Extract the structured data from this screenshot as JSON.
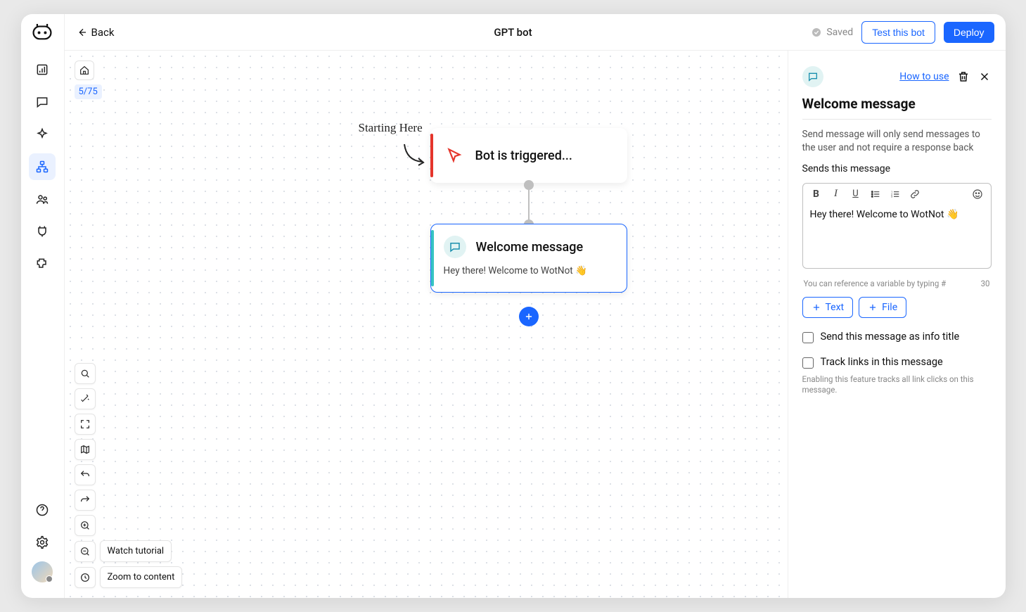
{
  "header": {
    "back_label": "Back",
    "title": "GPT bot",
    "saved_label": "Saved",
    "test_label": "Test this bot",
    "deploy_label": "Deploy"
  },
  "canvas": {
    "node_counter": "5/75",
    "starting_label": "Starting Here",
    "trigger_label": "Bot is triggered...",
    "message_label": "Welcome message",
    "message_preview": "Hey there! Welcome to WotNot 👋",
    "watch_tutorial": "Watch tutorial",
    "zoom_to_content": "Zoom to content"
  },
  "panel": {
    "how_to_use": "How to use",
    "title": "Welcome message",
    "description": "Send message will only send messages to the user and not require a response back",
    "sends_label": "Sends this message",
    "message_value": "Hey there! Welcome to WotNot 👋",
    "var_hint": "You can reference a variable by typing #",
    "char_count": "30",
    "add_text": "Text",
    "add_file": "File",
    "checkbox_info_title": "Send this message as info title",
    "checkbox_track_links": "Track links in this message",
    "track_links_hint": "Enabling this feature tracks all link clicks on this message."
  }
}
